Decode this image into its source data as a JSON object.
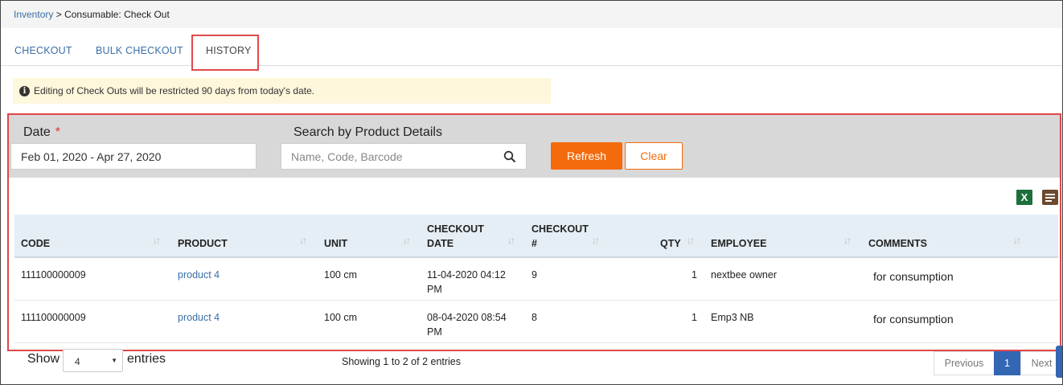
{
  "breadcrumb": {
    "root": "Inventory",
    "separator": ">",
    "current": "Consumable: Check Out"
  },
  "tabs": [
    {
      "label": "CHECKOUT"
    },
    {
      "label": "BULK CHECKOUT"
    },
    {
      "label": "HISTORY",
      "active": true
    }
  ],
  "notice": {
    "icon": "info-icon",
    "text": "Editing of Check Outs will be restricted 90 days from today's date."
  },
  "filters": {
    "date_label": "Date",
    "date_required_mark": "*",
    "date_value": "Feb 01, 2020 - Apr 27, 2020",
    "search_label": "Search by Product Details",
    "search_placeholder": "Name, Code, Barcode",
    "refresh_label": "Refresh",
    "clear_label": "Clear"
  },
  "export": {
    "excel_label": "X",
    "excel_icon": "excel-icon",
    "columns_icon": "list-icon"
  },
  "table": {
    "columns": [
      "CODE",
      "PRODUCT",
      "UNIT",
      "CHECKOUT DATE",
      "CHECKOUT #",
      "QTY",
      "EMPLOYEE",
      "COMMENTS"
    ],
    "column_lines": {
      "checkout_date": [
        "CHECKOUT",
        "DATE"
      ],
      "checkout_num": [
        "CHECKOUT",
        "#"
      ]
    },
    "sort_glyph": "↓↑",
    "rows": [
      {
        "code": "111100000009",
        "product": "product 4",
        "unit": "100 cm",
        "date": "11-04-2020 04:12",
        "date_line2": "PM",
        "checkout_no": "9",
        "qty": "1",
        "employee": "nextbee owner",
        "comments": "for consumption"
      },
      {
        "code": "111100000009",
        "product": "product 4",
        "unit": "100 cm",
        "date": "08-04-2020 08:54",
        "date_line2": "PM",
        "checkout_no": "8",
        "qty": "1",
        "employee": "Emp3 NB",
        "comments": "for consumption"
      }
    ]
  },
  "footer": {
    "show_label": "Show",
    "page_size": "4",
    "entries_label": "entries",
    "showing_text": "Showing 1 to 2 of 2 entries",
    "prev_label": "Previous",
    "current_page": "1",
    "next_label": "Next"
  },
  "colors": {
    "accent": "#f36b0c",
    "link": "#3a6ea5",
    "highlight": "#e04848",
    "page_active": "#3366b3"
  }
}
